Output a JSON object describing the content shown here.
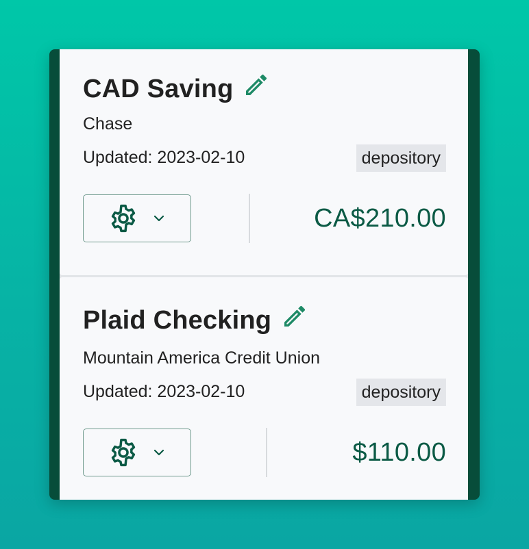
{
  "theme": {
    "background_top": "#00c7a8",
    "background_bottom": "#0aa6a3",
    "frame": "#074d3a",
    "accent": "#1e8a66",
    "amount": "#0b5a45"
  },
  "accounts": [
    {
      "name": "CAD Saving",
      "institution": "Chase",
      "updated": "Updated: 2023-02-10",
      "type_badge": "depository",
      "balance": "CA$210.00",
      "edit_icon": "pencil-icon",
      "settings_icon": "gear-icon",
      "dropdown_icon": "chevron-down-icon"
    },
    {
      "name": "Plaid Checking",
      "institution": "Mountain America Credit Union",
      "updated": "Updated: 2023-02-10",
      "type_badge": "depository",
      "balance": "$110.00",
      "edit_icon": "pencil-icon",
      "settings_icon": "gear-icon",
      "dropdown_icon": "chevron-down-icon"
    }
  ]
}
